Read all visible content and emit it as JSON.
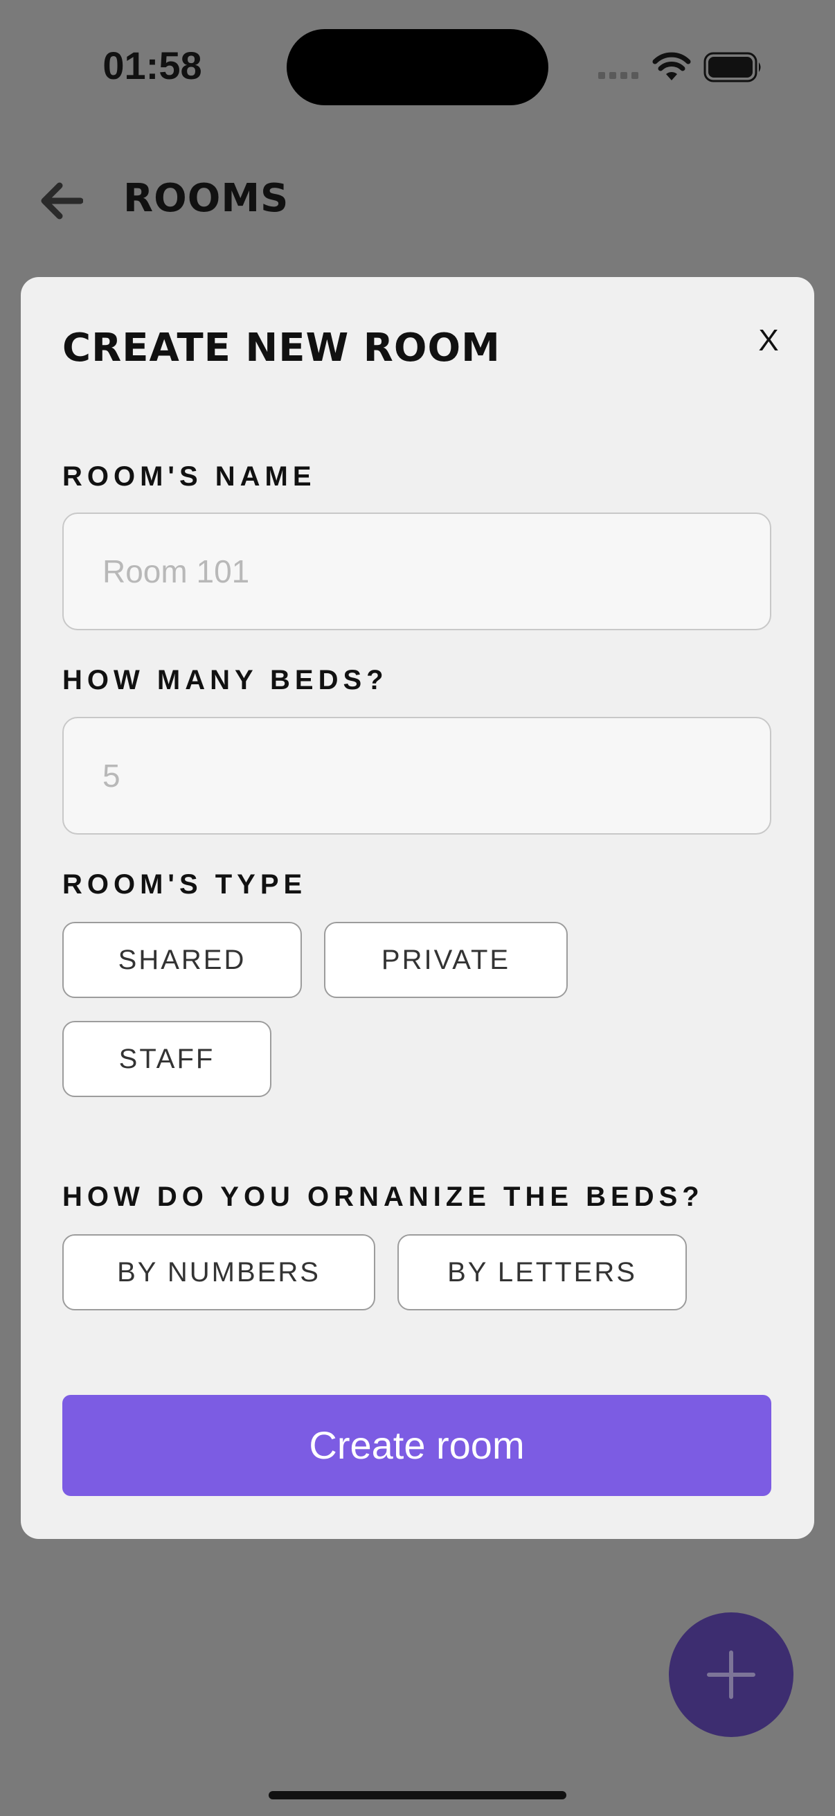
{
  "status_bar": {
    "time": "01:58",
    "icons": [
      "signal-icon",
      "wifi-icon",
      "battery-icon"
    ]
  },
  "top_bar": {
    "back_icon": "back-arrow-icon",
    "title": "ROOMS"
  },
  "modal": {
    "title": "CREATE NEW ROOM",
    "close_label": "X",
    "room_name": {
      "label": "ROOM'S NAME",
      "value": "",
      "placeholder": "Room 101"
    },
    "beds": {
      "label": "HOW MANY BEDS?",
      "value": "",
      "placeholder": "5"
    },
    "room_type": {
      "label": "ROOM'S TYPE",
      "options": [
        "SHARED",
        "PRIVATE",
        "STAFF"
      ]
    },
    "bed_organization": {
      "label": "HOW DO YOU ORNANIZE THE BEDS?",
      "options": [
        "BY NUMBERS",
        "BY LETTERS"
      ]
    },
    "submit_label": "Create room"
  },
  "fab": {
    "icon": "plus-icon"
  },
  "colors": {
    "backdrop": "#7a7a7a",
    "modal_background": "#f0f0f0",
    "accent": "#7c5ce3",
    "fab": "#3d2d70"
  }
}
